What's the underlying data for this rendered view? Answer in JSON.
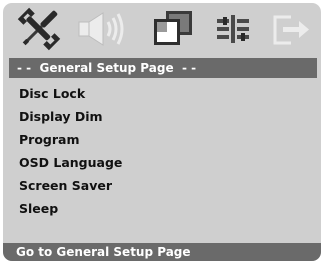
{
  "tabs": [
    {
      "icon": "tools-icon",
      "state": "selected"
    },
    {
      "icon": "speaker-icon",
      "state": "dimmed"
    },
    {
      "icon": "video-screens-icon",
      "state": "normal"
    },
    {
      "icon": "preferences-icon",
      "state": "normal"
    },
    {
      "icon": "exit-icon",
      "state": "dimmed"
    }
  ],
  "header": {
    "title": "- -  General Setup Page  - -"
  },
  "menu": {
    "items": [
      {
        "label": "Disc Lock"
      },
      {
        "label": "Display Dim"
      },
      {
        "label": "Program"
      },
      {
        "label": "OSD Language"
      },
      {
        "label": "Screen Saver"
      },
      {
        "label": "Sleep"
      }
    ]
  },
  "status": {
    "text": "Go to General Setup Page"
  },
  "colors": {
    "panel": "#cfcfcf",
    "bar": "#6a6a6a",
    "text": "#111111",
    "bar_text": "#ffffff"
  }
}
